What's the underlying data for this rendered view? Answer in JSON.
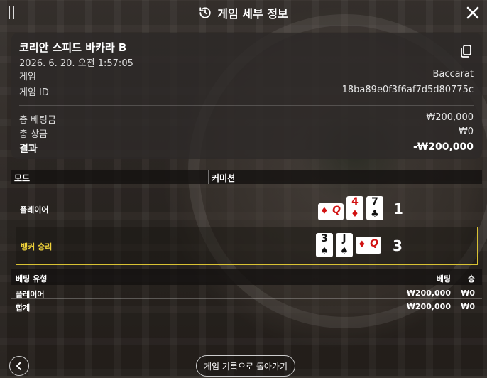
{
  "header": {
    "title": "게임 세부 정보"
  },
  "summary": {
    "game_name": "코리안 스피드 바카라 B",
    "datetime": "2026. 6. 20. 오전 1:57:05",
    "game_label": "게임",
    "game_value": "Baccarat",
    "game_id_label": "게임 ID",
    "game_id_value": "18ba89e0f3f6af7d5d80775c",
    "total_bet_label": "총 베팅금",
    "total_bet_value": "₩200,000",
    "total_win_label": "총 상금",
    "total_win_value": "₩0",
    "result_label": "결과",
    "result_value": "-₩200,000"
  },
  "mode_bar": {
    "mode": "모드",
    "commission": "커미션"
  },
  "hands": {
    "player": {
      "label": "플레이어",
      "score": "1",
      "cards": [
        {
          "rank": "Q",
          "suit": "♦",
          "color": "#d11111",
          "orientation": "horizontal"
        },
        {
          "rank": "4",
          "suit": "♦",
          "color": "#d11111",
          "orientation": "vertical"
        },
        {
          "rank": "7",
          "suit": "♣",
          "color": "#111111",
          "orientation": "vertical"
        }
      ]
    },
    "banker": {
      "label": "뱅커 승리",
      "score": "3",
      "cards": [
        {
          "rank": "3",
          "suit": "♠",
          "color": "#111111",
          "orientation": "vertical"
        },
        {
          "rank": "J",
          "suit": "♠",
          "color": "#111111",
          "orientation": "vertical"
        },
        {
          "rank": "Q",
          "suit": "♦",
          "color": "#d11111",
          "orientation": "horizontal"
        }
      ]
    }
  },
  "bets": {
    "headers": {
      "type": "베팅 유형",
      "bet": "베팅",
      "win": "승"
    },
    "rows": [
      {
        "type": "플레이어",
        "bet": "₩200,000",
        "win": "₩0"
      },
      {
        "type": "합계",
        "bet": "₩200,000",
        "win": "₩0"
      }
    ]
  },
  "footer": {
    "back_label": "게임 기록으로 돌아가기"
  },
  "colors": {
    "winner_border": "#d9c233",
    "winner_text": "#f0d23a",
    "red_suit": "#d11111"
  }
}
